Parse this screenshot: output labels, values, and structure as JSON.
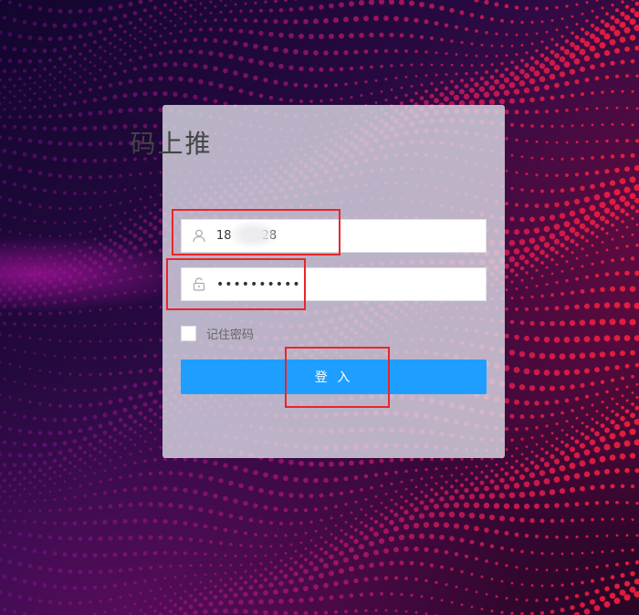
{
  "login": {
    "title": "码上推",
    "username": {
      "value": "18        28",
      "icon": "user-icon"
    },
    "password": {
      "value": "••••••••••",
      "icon": "lock-icon"
    },
    "remember_label": "记住密码",
    "remember_checked": false,
    "submit_label": "登 入"
  },
  "colors": {
    "primary_button": "#1e9fff",
    "annotation": "#e8262b",
    "card_background": "#dad8e4"
  }
}
